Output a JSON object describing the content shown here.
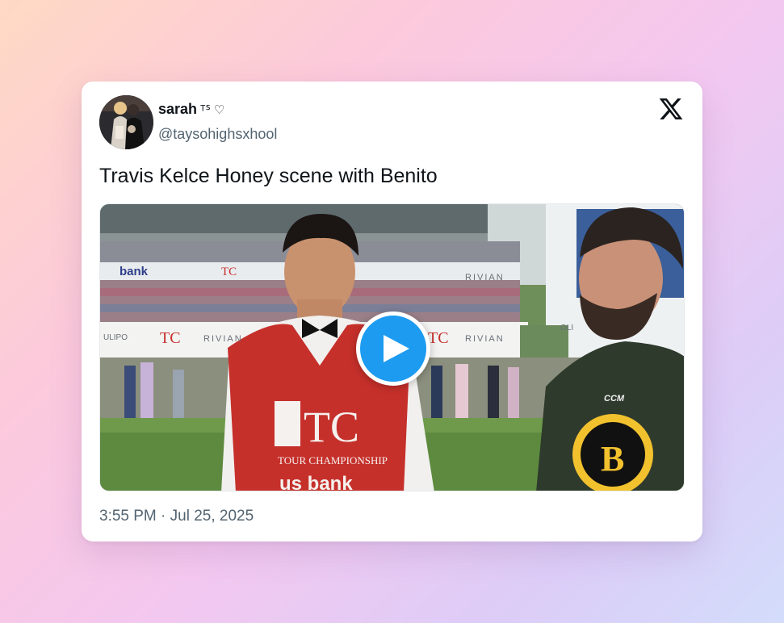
{
  "tweet": {
    "display_name": "sarah",
    "name_suffix": "ᵀᔆ ♡",
    "handle": "@taysohighsxhool",
    "text": "Travis Kelce Honey scene with Benito",
    "timestamp": "3:55 PM · Jul 25, 2025"
  },
  "media": {
    "banner_texts": {
      "bank_a": "bank",
      "rivian_a": "RIVIAN",
      "rivian_b": "RIVIAN",
      "rivian_c": "RIVIAN",
      "tc_small_a": "TC",
      "tc_small_b": "TC",
      "tc_small_c": "TC",
      "ulipo": "ULIPO",
      "oli": "OLI",
      "vest_tc": "TC",
      "vest_line": "TOUR CHAMPIONSHIP",
      "vest_bank": "us bank",
      "jersey_brand": "CCM",
      "jersey_logo": "B"
    }
  },
  "colors": {
    "accent_blue": "#1d9bf0",
    "text_primary": "#0f1419",
    "text_secondary": "#536471",
    "vest_red": "#c6302b"
  },
  "icons": {
    "x_logo": "x-logo-icon",
    "play": "play-icon"
  }
}
